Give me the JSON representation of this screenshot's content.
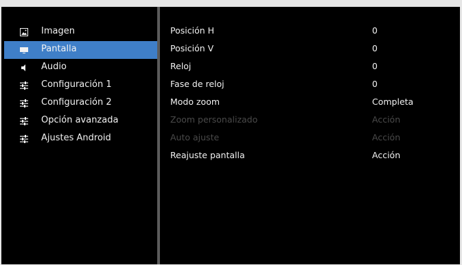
{
  "sidebar": {
    "items": [
      {
        "label": "Imagen",
        "icon": "image-icon",
        "active": false
      },
      {
        "label": "Pantalla",
        "icon": "display-icon",
        "active": true
      },
      {
        "label": "Audio",
        "icon": "speaker-icon",
        "active": false
      },
      {
        "label": "Configuración 1",
        "icon": "sliders-icon",
        "active": false
      },
      {
        "label": "Configuración 2",
        "icon": "sliders-icon",
        "active": false
      },
      {
        "label": "Opción avanzada",
        "icon": "sliders-icon",
        "active": false
      },
      {
        "label": "Ajustes Android",
        "icon": "sliders-icon",
        "active": false
      }
    ]
  },
  "settings": {
    "rows": [
      {
        "label": "Posición H",
        "value": "0",
        "enabled": true
      },
      {
        "label": "Posición V",
        "value": "0",
        "enabled": true
      },
      {
        "label": "Reloj",
        "value": "0",
        "enabled": true
      },
      {
        "label": "Fase de reloj",
        "value": "0",
        "enabled": true
      },
      {
        "label": "Modo zoom",
        "value": "Completa",
        "enabled": true
      },
      {
        "label": "Zoom personalizado",
        "value": "Acción",
        "enabled": false
      },
      {
        "label": "Auto ajuste",
        "value": "Acción",
        "enabled": false
      },
      {
        "label": "Reajuste pantalla",
        "value": "Acción",
        "enabled": true
      }
    ]
  },
  "colors": {
    "active_item": "#3f7fc8",
    "background": "#000000",
    "text": "#f2f2f2",
    "disabled_text": "#4a4a4a",
    "divider": "#5b5b5b"
  }
}
